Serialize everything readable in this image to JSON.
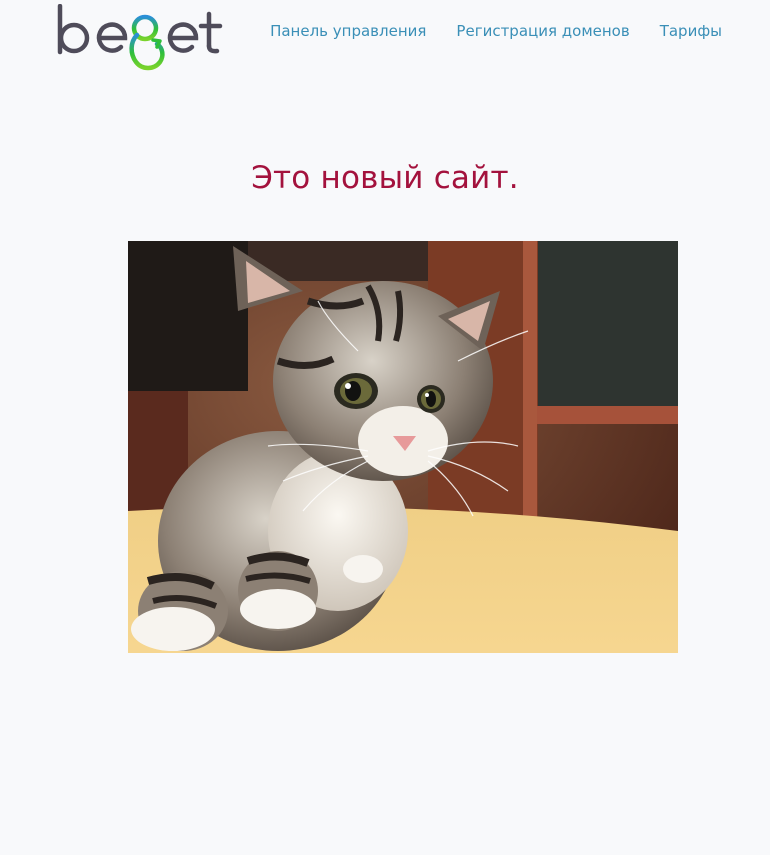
{
  "header": {
    "logo": {
      "text": "beget",
      "colors": {
        "gray": "#4f4c5a",
        "green": "#2fbf3a",
        "blue": "#2a8fd8"
      }
    },
    "nav": [
      {
        "label": "Панель управления"
      },
      {
        "label": "Регистрация доменов"
      },
      {
        "label": "Тарифы"
      }
    ]
  },
  "main": {
    "title": "Это новый сайт.",
    "image": {
      "icon": "kitten-photo"
    }
  },
  "colors": {
    "background": "#f8f9fb",
    "link": "#3a8fb7",
    "title": "#a3123d"
  }
}
